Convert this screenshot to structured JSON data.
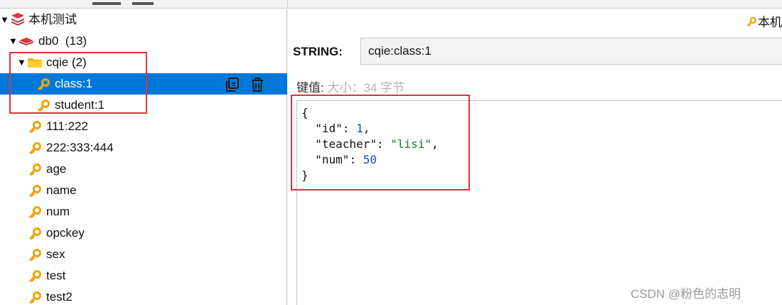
{
  "tree": {
    "root": {
      "label": "本机测试"
    },
    "db": {
      "label": "db0",
      "count": "(13)"
    },
    "folder": {
      "label": "cqie",
      "count": "(2)"
    },
    "folder_keys": [
      "class:1",
      "student:1"
    ],
    "keys": [
      "111:222",
      "222:333:444",
      "age",
      "name",
      "num",
      "opckey",
      "sex",
      "test",
      "test2"
    ]
  },
  "detail": {
    "server_label": "本机",
    "type_label": "STRING:",
    "key_value": "cqie:class:1",
    "value_caption": "键值:",
    "size_text": "大小：34 字节",
    "json": {
      "open": "{",
      "id_key": "\"id\"",
      "id_val": "1",
      "teacher_key": "\"teacher\"",
      "teacher_val": "\"lisi\"",
      "num_key": "\"num\"",
      "num_val": "50",
      "close": "}"
    }
  },
  "watermark": "CSDN @粉色的志明",
  "colors": {
    "selection": "#0078d7",
    "key_icon": "#f0a30a",
    "highlight_box": "#e1313b",
    "db_icon": "#d9343a",
    "folder_icon": "#f5b800"
  }
}
